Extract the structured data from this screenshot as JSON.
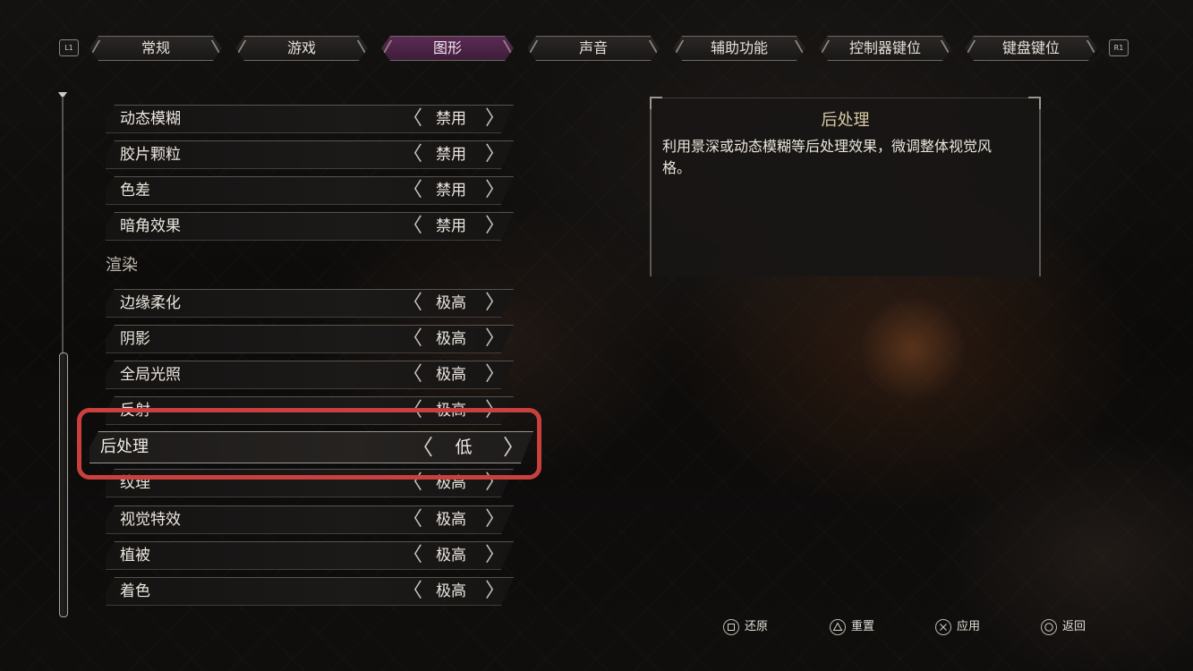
{
  "tabs": {
    "left_shoulder": "L1",
    "right_shoulder": "R1",
    "items": [
      {
        "label": "常规",
        "active": false
      },
      {
        "label": "游戏",
        "active": false
      },
      {
        "label": "图形",
        "active": true
      },
      {
        "label": "声音",
        "active": false
      },
      {
        "label": "辅助功能",
        "active": false
      },
      {
        "label": "控制器键位",
        "active": false
      },
      {
        "label": "键盘键位",
        "active": false
      }
    ]
  },
  "settings": {
    "rows_top": [
      {
        "label": "动态模糊",
        "value": "禁用"
      },
      {
        "label": "胶片颗粒",
        "value": "禁用"
      },
      {
        "label": "色差",
        "value": "禁用"
      },
      {
        "label": "暗角效果",
        "value": "禁用"
      }
    ],
    "section_title": "渲染",
    "rows_render": [
      {
        "label": "边缘柔化",
        "value": "极高"
      },
      {
        "label": "阴影",
        "value": "极高"
      },
      {
        "label": "全局光照",
        "value": "极高"
      },
      {
        "label": "反射",
        "value": "极高"
      }
    ],
    "selected": {
      "label": "后处理",
      "value": "低"
    },
    "rows_bottom": [
      {
        "label": "纹理",
        "value": "极高"
      },
      {
        "label": "视觉特效",
        "value": "极高"
      },
      {
        "label": "植被",
        "value": "极高"
      },
      {
        "label": "着色",
        "value": "极高"
      }
    ],
    "arrow_left": "〈",
    "arrow_right": "〉"
  },
  "description": {
    "title": "后处理",
    "body": "利用景深或动态模糊等后处理效果，微调整体视觉风格。"
  },
  "footer": {
    "reset": {
      "icon": "square-button-icon",
      "label": "还原"
    },
    "default": {
      "icon": "triangle-button-icon",
      "label": "重置"
    },
    "apply": {
      "icon": "cross-button-icon",
      "label": "应用"
    },
    "back": {
      "icon": "circle-button-icon",
      "label": "返回"
    }
  },
  "colors": {
    "active_tab": "#5b2b55",
    "highlight_border": "#c9403e",
    "description_title": "#d9c9a6"
  }
}
